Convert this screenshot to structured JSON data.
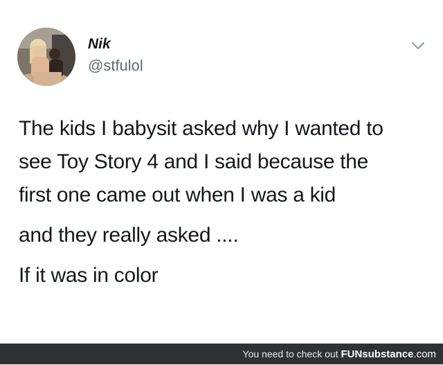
{
  "tweet": {
    "author": {
      "name": "Nik",
      "handle": "@stfulol"
    },
    "lines": [
      "The kids I babysit asked why I wanted to",
      "see Toy Story 4 and I said because the",
      "first one came out when I was a kid",
      "and they really asked ....",
      "If it was in color"
    ]
  },
  "footer": {
    "prefix": "You need to check out",
    "brand_bold": "FUNsubstance",
    "brand_tail": ".com"
  },
  "colors": {
    "text": "#14171a",
    "handle": "#5f6a74",
    "footer_bg": "#2f3235"
  },
  "icons": {
    "menu": "chevron-down-icon"
  }
}
